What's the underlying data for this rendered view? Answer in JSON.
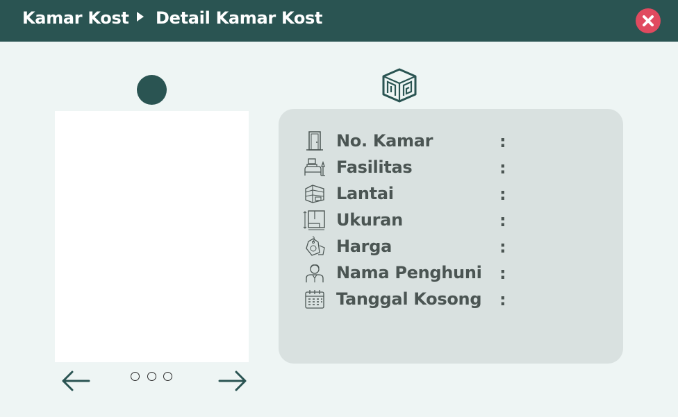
{
  "header": {
    "breadcrumb": [
      "Kamar Kost",
      "Detail Kamar Kost"
    ]
  },
  "gallery": {
    "pages": 3
  },
  "details": [
    {
      "label": "No. Kamar",
      "icon": "door-icon",
      "value": ""
    },
    {
      "label": "Fasilitas",
      "icon": "bedroom-icon",
      "value": ""
    },
    {
      "label": "Lantai",
      "icon": "building-floor-icon",
      "value": ""
    },
    {
      "label": "Ukuran",
      "icon": "room-size-icon",
      "value": ""
    },
    {
      "label": "Harga",
      "icon": "price-tag-icon",
      "value": ""
    },
    {
      "label": "Nama Penghuni",
      "icon": "tenant-icon",
      "value": ""
    },
    {
      "label": "Tanggal Kosong",
      "icon": "calendar-icon",
      "value": ""
    }
  ],
  "colors": {
    "topbar": "#2a5452",
    "background": "#eef5f4",
    "card": "#d9e1e0",
    "close": "#e04a5f",
    "text": "#4b5553"
  }
}
